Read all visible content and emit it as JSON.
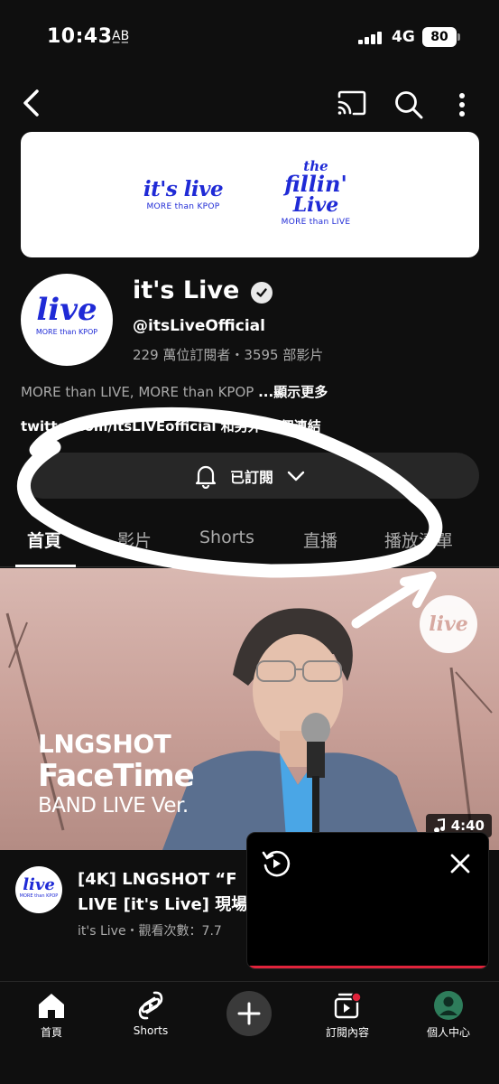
{
  "status_bar": {
    "time": "10:43",
    "time_badge": "A̲B̲",
    "network": "4G",
    "battery": "80"
  },
  "top_bar": {
    "back_icon": "chevron-left-icon",
    "cast_icon": "cast-icon",
    "search_icon": "search-icon",
    "more_icon": "more-vert-icon"
  },
  "banner": {
    "left_logo": "it's live",
    "left_sub": "MORE than KPOP",
    "right_the": "the",
    "right_fillin": "fillin'",
    "right_live": "Live",
    "right_sub": "MORE than LIVE"
  },
  "channel": {
    "avatar_logo": "live",
    "avatar_sub": "MORE than KPOP",
    "name": "it's Live",
    "handle": "@itsLiveOfficial",
    "stats": "229 萬位訂閱者・3595 部影片",
    "description": "MORE than LIVE, MORE than KPOP ",
    "show_more": "...顯示更多",
    "links": "twitter.com/itsLIVEofficial 和另外 1 個連結"
  },
  "subscribe": {
    "label": "已訂閱"
  },
  "tabs": [
    {
      "label": "首頁",
      "active": true
    },
    {
      "label": "影片",
      "active": false
    },
    {
      "label": "Shorts",
      "active": false
    },
    {
      "label": "直播",
      "active": false
    },
    {
      "label": "播放清單",
      "active": false
    }
  ],
  "video": {
    "thumb_logo": "live",
    "thumb_line1": "LNGSHOT",
    "thumb_line2": "FaceTime",
    "thumb_line3": "BAND LIVE Ver.",
    "duration": "4:40",
    "channel_logo": "live",
    "channel_logo_sub": "MORE than KPOP",
    "title_line1": "[4K] LNGSHOT “F",
    "title_line2": "LIVE [it's Live] 現場",
    "meta": "it's Live・觀看次數：7.7"
  },
  "mini_player": {
    "replay_icon": "replay-icon",
    "close_icon": "close-icon"
  },
  "bottom_nav": [
    {
      "label": "首頁",
      "icon": "home-icon"
    },
    {
      "label": "Shorts",
      "icon": "shorts-icon"
    },
    {
      "label": "",
      "icon": "add-icon"
    },
    {
      "label": "訂閱內容",
      "icon": "subscriptions-icon"
    },
    {
      "label": "個人中心",
      "icon": "profile-icon"
    }
  ],
  "colors": {
    "background": "#0f0f0f",
    "brand_blue": "#1f2ad6",
    "progress_red": "#e0233b",
    "chip_gray": "#272727"
  }
}
